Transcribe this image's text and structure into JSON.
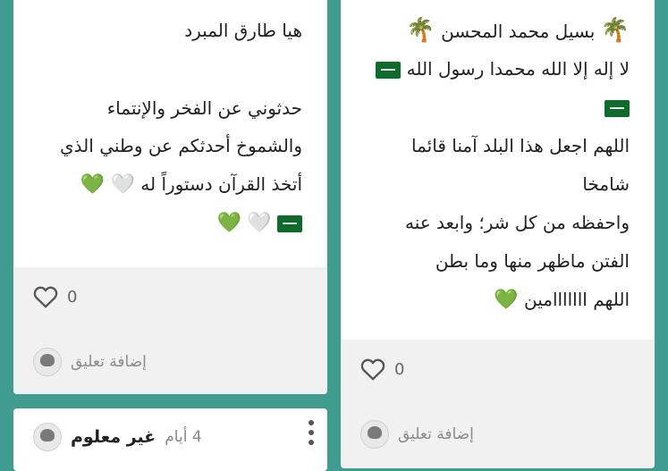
{
  "left_card": {
    "title": "هيا طارق المبرد",
    "lines": [
      "حدثوني عن الفخر والإنتماء",
      "والشموخ أحدثكم عن وطني الذي",
      "أتخذ القرآن دستوراً له"
    ],
    "like_count": "0",
    "comment_label": "إضافة تعليق"
  },
  "right_card": {
    "lines": [
      "بسيل محمد المحسن",
      "لا إله إلا الله محمدا رسول الله",
      "اللهم اجعل هذا البلد آمنا قائما",
      "شامخا",
      "واحفظه من كل شر؛ وابعد عنه",
      "الفتن ماظهر منها وما بطن",
      "اللهم ااااااامين"
    ],
    "like_count": "0",
    "comment_label": "إضافة تعليق"
  },
  "bottom_card": {
    "user_name": "غير معلوم",
    "time": "4 أيام"
  },
  "icons": {
    "palm": "🌴",
    "green_heart": "💚",
    "white_heart": "🤍",
    "flag": "saudi-flag",
    "like": "heart-outline-icon",
    "more": "vertical-dots-icon"
  },
  "colors": {
    "background": "#3f9c8f",
    "green_heart": "#2ecc40"
  }
}
